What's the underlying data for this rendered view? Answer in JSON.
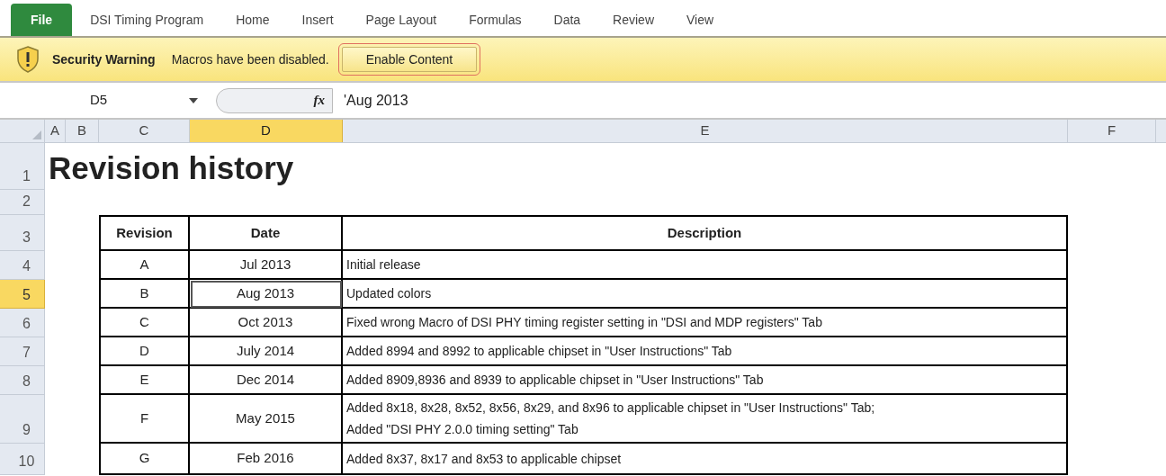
{
  "ribbon_tabs": [
    {
      "label": "File",
      "kind": "file",
      "selected": false
    },
    {
      "label": "DSI Timing Program",
      "kind": "tab",
      "selected": false
    },
    {
      "label": "Home",
      "kind": "tab",
      "selected": false
    },
    {
      "label": "Insert",
      "kind": "tab",
      "selected": false
    },
    {
      "label": "Page Layout",
      "kind": "tab",
      "selected": false
    },
    {
      "label": "Formulas",
      "kind": "tab",
      "selected": false
    },
    {
      "label": "Data",
      "kind": "tab",
      "selected": false
    },
    {
      "label": "Review",
      "kind": "tab",
      "selected": false
    },
    {
      "label": "View",
      "kind": "tab",
      "selected": false
    }
  ],
  "security_bar": {
    "title": "Security Warning",
    "message": "Macros have been disabled.",
    "button": "Enable Content"
  },
  "formula_bar": {
    "name_box": "D5",
    "fx": "fx",
    "formula": "'Aug 2013"
  },
  "column_headers": [
    {
      "label": "A",
      "selected": false
    },
    {
      "label": "B",
      "selected": false
    },
    {
      "label": "C",
      "selected": false
    },
    {
      "label": "D",
      "selected": true
    },
    {
      "label": "E",
      "selected": false
    },
    {
      "label": "F",
      "selected": false
    }
  ],
  "row_headers": [
    {
      "label": "1",
      "selected": false
    },
    {
      "label": "2",
      "selected": false
    },
    {
      "label": "3",
      "selected": false
    },
    {
      "label": "4",
      "selected": false
    },
    {
      "label": "5",
      "selected": true
    },
    {
      "label": "6",
      "selected": false
    },
    {
      "label": "7",
      "selected": false
    },
    {
      "label": "8",
      "selected": false
    },
    {
      "label": "9",
      "selected": false
    },
    {
      "label": "10",
      "selected": false
    }
  ],
  "sheet": {
    "title": "Revision history",
    "table": {
      "columns": [
        "Revision",
        "Date",
        "Description"
      ],
      "rows": [
        {
          "revision": "A",
          "date": "Jul 2013",
          "description": "Initial release",
          "selected": false
        },
        {
          "revision": "B",
          "date": "Aug 2013",
          "description": "Updated colors",
          "selected": true
        },
        {
          "revision": "C",
          "date": "Oct 2013",
          "description": "Fixed wrong Macro of DSI PHY timing register setting in \"DSI and MDP registers\" Tab",
          "selected": false
        },
        {
          "revision": "D",
          "date": "July 2014",
          "description": "Added 8994 and 8992 to applicable chipset in \"User Instructions\" Tab",
          "selected": false
        },
        {
          "revision": "E",
          "date": "Dec 2014",
          "description": "Added 8909,8936 and 8939 to applicable chipset in \"User Instructions\" Tab",
          "selected": false
        },
        {
          "revision": "F",
          "date": "May 2015",
          "description": "Added 8x18, 8x28, 8x52, 8x56, 8x29, and 8x96 to applicable chipset in \"User Instructions\" Tab;\nAdded \"DSI PHY 2.0.0 timing setting\" Tab",
          "selected": false
        },
        {
          "revision": "G",
          "date": "Feb 2016",
          "description": "Added 8x37, 8x17 and 8x53 to applicable chipset",
          "selected": false
        }
      ]
    }
  }
}
